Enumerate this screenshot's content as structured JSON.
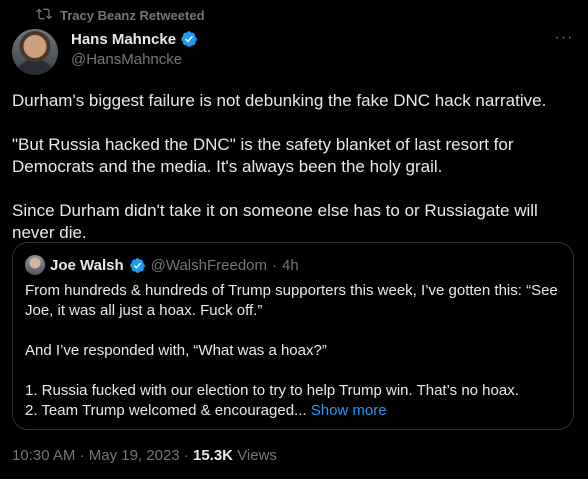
{
  "retweet": {
    "label": "Tracy Beanz Retweeted",
    "icon": "retweet-icon"
  },
  "author": {
    "name": "Hans Mahncke",
    "handle": "@HansMahncke",
    "verified_color": "#1d9bf0"
  },
  "tweet": {
    "paragraphs": [
      "Durham's biggest failure is not debunking the fake DNC hack narrative.",
      "\"But Russia hacked the DNC\" is the safety blanket of last resort for Democrats and the media. It's always been the holy grail.",
      "Since Durham didn't take it on someone else has to or Russiagate will never die."
    ]
  },
  "quote": {
    "name": "Joe Walsh",
    "handle": "@WalshFreedom",
    "separator": "·",
    "time": "4h",
    "paragraphs": [
      "From hundreds & hundreds of Trump supporters this week, I’ve gotten this: “See Joe, it was all just a hoax. Fuck off.”",
      "And I’ve responded with, “What was a hoax?”",
      "1. Russia fucked with our election to try to help Trump win. That’s no hoax.",
      "2. Team Trump welcomed & encouraged..."
    ],
    "show_more": "Show more"
  },
  "meta": {
    "time": "10:30 AM",
    "sep1": "·",
    "date": "May 19, 2023",
    "sep2": "·",
    "views_count": "15.3K",
    "views_label": "Views"
  },
  "colors": {
    "background": "#000000",
    "text": "#e7e9ea",
    "muted": "#71767b",
    "accent": "#1d9bf0",
    "border": "#2f3336"
  }
}
